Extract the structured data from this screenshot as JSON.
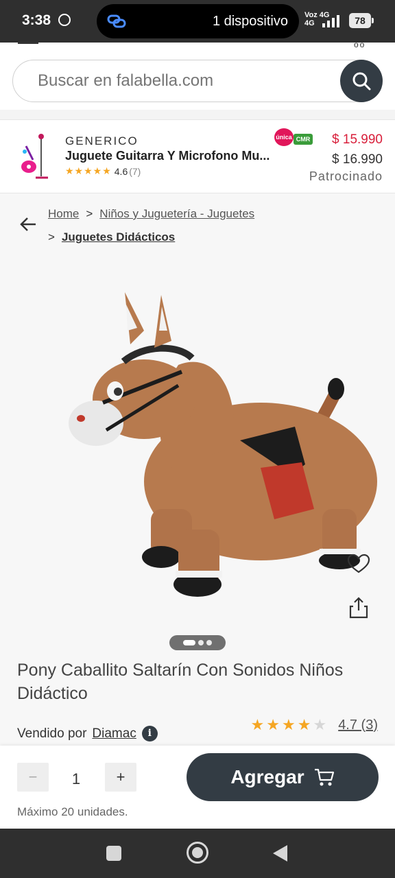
{
  "status_bar": {
    "time": "3:38",
    "device_text": "1 dispositivo",
    "network_top": "Voz 4G",
    "network_bottom": "4G",
    "battery": "78"
  },
  "search": {
    "placeholder": "Buscar en falabella.com"
  },
  "sponsored": {
    "brand": "GENERICO",
    "title": "Juguete Guitarra Y Microfono Mu...",
    "stars": "★★★★★",
    "rating": "4.6",
    "reviews": "(7)",
    "badge_unica": "única",
    "badge_cmr": "CMR",
    "price_cmr": "$ 15.990",
    "price_normal": "$ 16.990",
    "tag": "Patrocinado"
  },
  "breadcrumb": {
    "home": "Home",
    "sep": ">",
    "level1": "Niños y Juguetería - Juguetes",
    "level2": "Juguetes Didácticos"
  },
  "gallery": {
    "icons": [
      "heart-icon",
      "share-icon"
    ]
  },
  "product": {
    "title": "Pony Caballito Saltarín Con Sonidos Niños Didáctico",
    "sold_by_label": "Vendido por",
    "seller": "Diamac",
    "info_symbol": "i",
    "rating_value": "4.7 (3)",
    "stars_filled": 4,
    "stars_total": 5
  },
  "cart": {
    "minus": "−",
    "quantity": "1",
    "plus": "+",
    "max_note": "Máximo 20 unidades.",
    "add_label": "Agregar"
  },
  "colors": {
    "primary_dark": "#333c44",
    "price_red": "#d81e3a",
    "star": "#f5a623"
  }
}
